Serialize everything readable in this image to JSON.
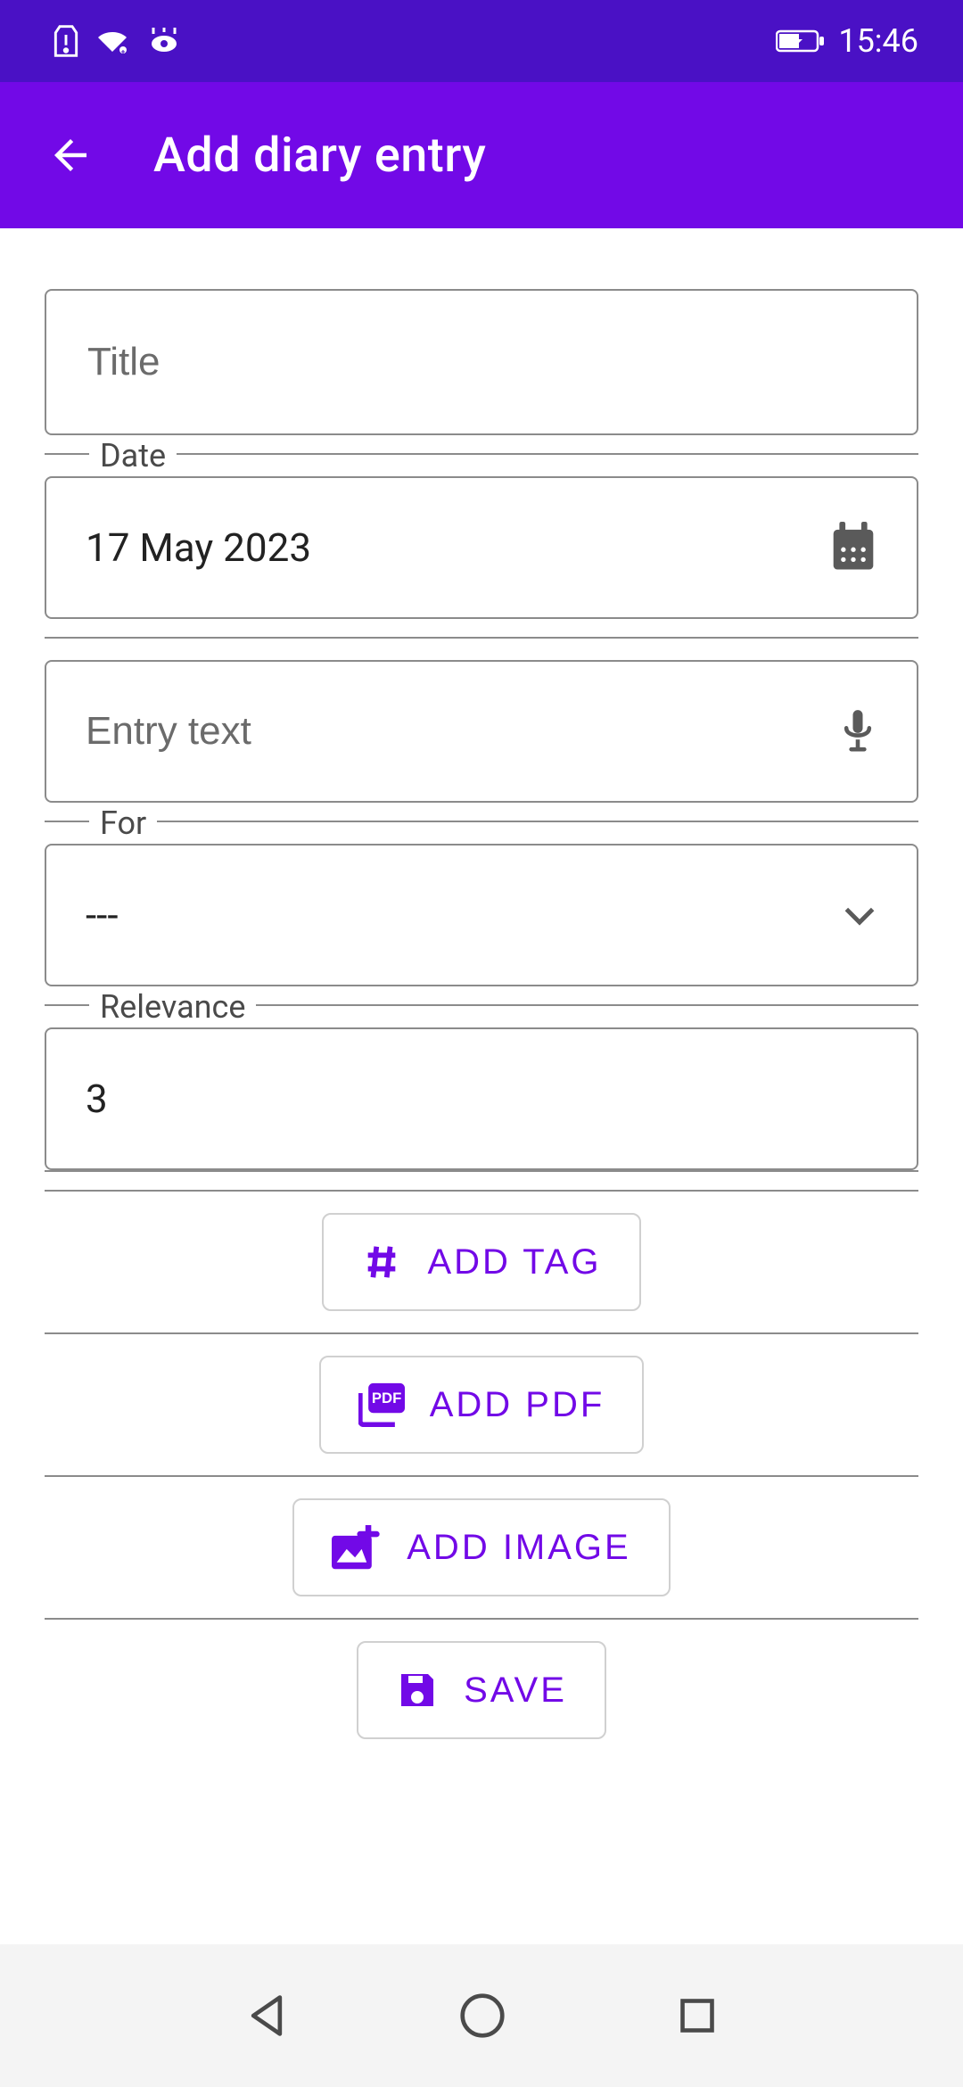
{
  "status_bar": {
    "time": "15:46"
  },
  "app_bar": {
    "title": "Add diary entry"
  },
  "fields": {
    "title": {
      "placeholder": "Title",
      "value": ""
    },
    "date": {
      "label": "Date",
      "value": "17 May 2023"
    },
    "entry": {
      "placeholder": "Entry text",
      "value": ""
    },
    "for": {
      "label": "For",
      "value": "---"
    },
    "relevance": {
      "label": "Relevance",
      "value": "3"
    }
  },
  "actions": {
    "add_tag": "ADD TAG",
    "add_pdf": "ADD PDF",
    "add_image": "ADD IMAGE",
    "save": "SAVE"
  }
}
